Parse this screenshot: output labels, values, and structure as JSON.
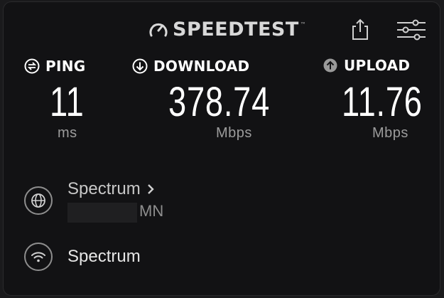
{
  "header": {
    "logo_text": "SPEEDTEST",
    "logo_mark": "™",
    "icons": [
      "speedometer-icon",
      "share-icon",
      "settings-sliders-icon"
    ]
  },
  "metrics": {
    "ping": {
      "label": "PING",
      "value": "11",
      "unit": "ms",
      "icon": "ping-swap-icon"
    },
    "download": {
      "label": "DOWNLOAD",
      "value": "378.74",
      "unit": "Mbps",
      "icon": "download-arrow-icon"
    },
    "upload": {
      "label": "UPLOAD",
      "value": "11.76",
      "unit": "Mbps",
      "icon": "upload-arrow-icon"
    }
  },
  "server": {
    "name": "Spectrum",
    "location_suffix": "MN",
    "icon": "globe-icon"
  },
  "provider": {
    "name": "Spectrum",
    "icon": "wifi-icon"
  },
  "colors": {
    "background": "#121214",
    "text": "#ffffff",
    "muted": "#9c9c9c"
  }
}
